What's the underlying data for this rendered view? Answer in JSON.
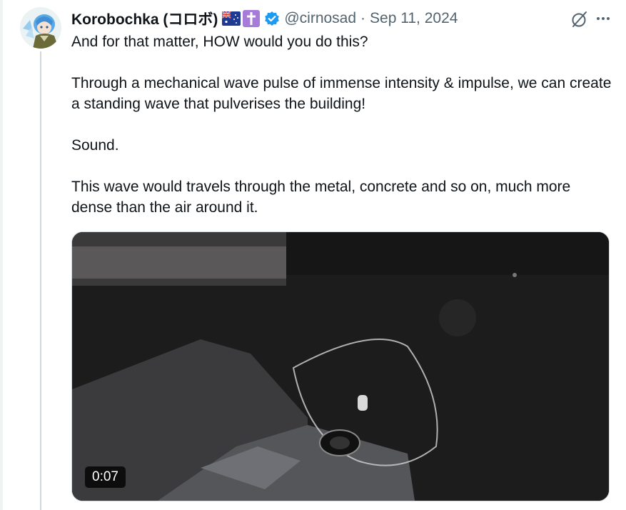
{
  "tweet": {
    "display_name": "Korobochka (コロボ)",
    "handle": "@cirnosad",
    "separator": "·",
    "date": "Sep 11, 2024",
    "paragraphs": [
      "And for that matter, HOW would you do this?",
      "Through a mechanical wave pulse of immense intensity & impulse, we can create a standing wave that pulverises the building!",
      "Sound.",
      "This wave would travels through the metal, concrete and so on, much more dense than the air around it."
    ],
    "badges": [
      "australia-flag-icon",
      "latin-cross-icon",
      "verified-badge-icon"
    ],
    "actions": [
      "grok-icon",
      "more-icon"
    ]
  },
  "video": {
    "duration": "0:07"
  },
  "colors": {
    "text": "#0f1419",
    "secondary": "#536471",
    "verified": "#1d9bf0",
    "cross_bg": "#a77bd8",
    "thread_line": "#cfd9de"
  }
}
